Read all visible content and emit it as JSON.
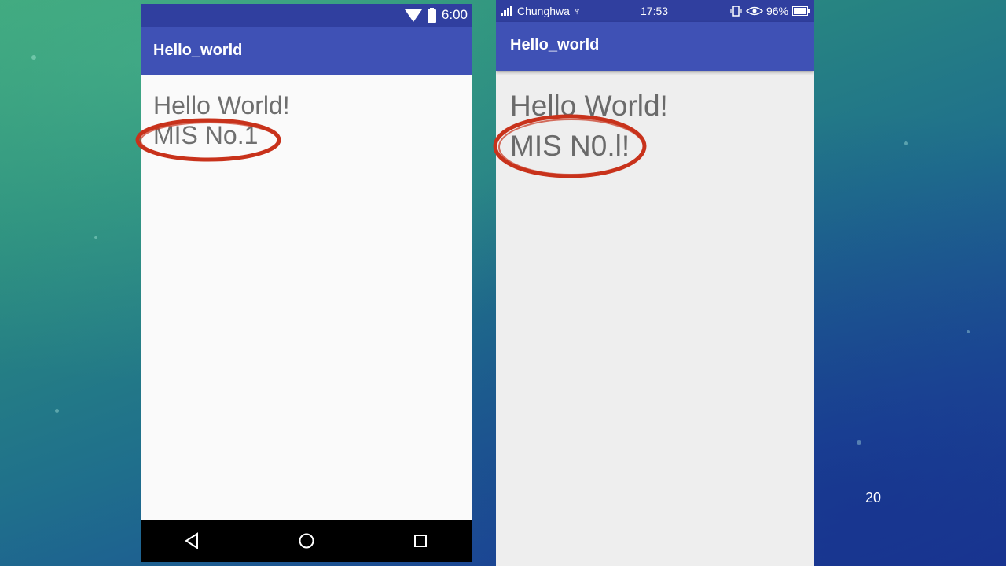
{
  "colors": {
    "status_bar": "#303f9f",
    "app_bar": "#3f51b5",
    "annotation": "#c8321b",
    "text": "#6f6f6f"
  },
  "phone_emulator": {
    "status": {
      "time": "6:00",
      "icons": [
        "wifi-icon",
        "battery-icon"
      ]
    },
    "app_title": "Hello_world",
    "text_line_1": "Hello World!",
    "text_line_2": "MIS No.1",
    "nav_buttons": [
      "back-icon",
      "home-icon",
      "recents-icon"
    ]
  },
  "phone_device": {
    "status": {
      "carrier": "Chunghwa ♆",
      "time": "17:53",
      "battery_percent": "96%",
      "icons": [
        "signal-icon",
        "usb-icon",
        "vibrate-icon",
        "eye-icon",
        "battery-icon"
      ]
    },
    "app_title": "Hello_world",
    "text_line_1": "Hello World!",
    "text_line_2": "MIS N0.l!"
  },
  "slide_number": "20"
}
